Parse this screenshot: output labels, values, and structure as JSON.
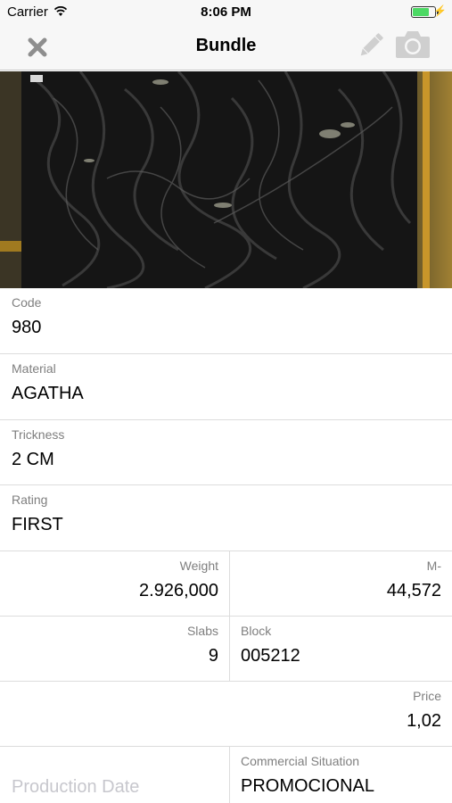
{
  "status_bar": {
    "carrier": "Carrier",
    "time": "8:06 PM",
    "battery_level": 0.7,
    "battery_color": "#4cd964"
  },
  "nav": {
    "title": "Bundle",
    "close_icon": "close-icon",
    "edit_icon": "pencil-icon",
    "camera_icon": "camera-icon"
  },
  "fields": {
    "code": {
      "label": "Code",
      "value": "980"
    },
    "material": {
      "label": "Material",
      "value": "AGATHA"
    },
    "thickness": {
      "label": "Trickness",
      "value": "2 CM"
    },
    "rating": {
      "label": "Rating",
      "value": "FIRST"
    },
    "weight": {
      "label": "Weight",
      "value": "2.926,000"
    },
    "m2": {
      "label": "M-",
      "value": "44,572"
    },
    "slabs": {
      "label": "Slabs",
      "value": "9"
    },
    "block": {
      "label": "Block",
      "value": "005212"
    },
    "price": {
      "label": "Price",
      "value": "1,02"
    },
    "production_date": {
      "placeholder": "Production Date"
    },
    "commercial_situation": {
      "label": "Commercial Situation",
      "value": "PROMOCIONAL"
    }
  }
}
